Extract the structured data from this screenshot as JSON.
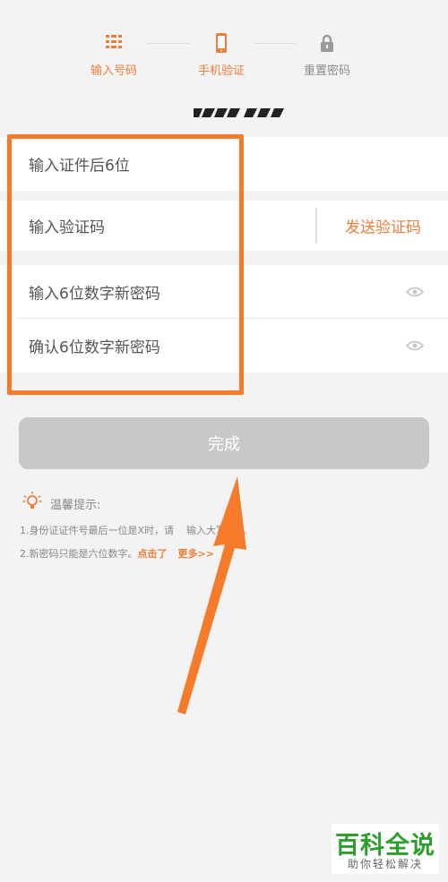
{
  "steps": [
    {
      "label": "输入号码",
      "icon": "id-card-icon",
      "state": "active"
    },
    {
      "label": "手机验证",
      "icon": "phone-icon",
      "state": "current"
    },
    {
      "label": "重置密码",
      "icon": "lock-icon",
      "state": "inactive"
    }
  ],
  "form": {
    "id_last6_placeholder": "输入证件后6位",
    "code_placeholder": "输入验证码",
    "send_code_label": "发送验证码",
    "new_password_placeholder": "输入6位数字新密码",
    "confirm_password_placeholder": "确认6位数字新密码"
  },
  "submit_label": "完成",
  "tips": {
    "title": "温馨提示:",
    "line1": "1.身份证证件号最后一位是X时，请",
    "line1_tail": "输入大写的X。",
    "line2": "2.新密码只能是六位数字。",
    "line2_link": "点击了",
    "line2_link_tail": "更多>>"
  },
  "watermark": {
    "name": "百科全说",
    "slogan": "助你轻松解决"
  },
  "colors": {
    "accent": "#ef7d39",
    "annotation": "#f57a2a",
    "button_disabled": "#c8c8c8",
    "brand_green": "#2c9e2c"
  }
}
